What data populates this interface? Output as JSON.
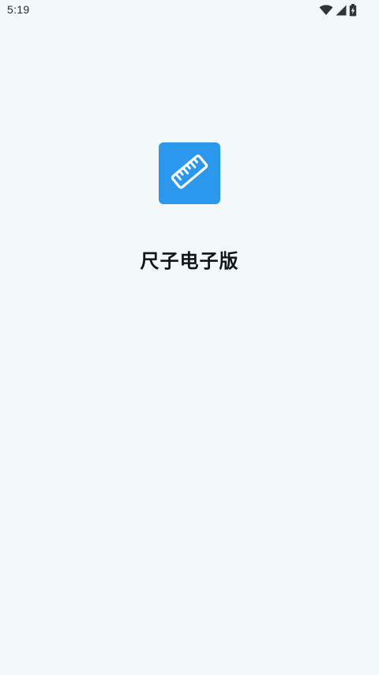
{
  "status_bar": {
    "time": "5:19",
    "icons": [
      "wifi-icon",
      "cellular-signal-icon",
      "battery-charging-icon"
    ]
  },
  "splash": {
    "icon": "ruler-icon",
    "icon_color": "#2b98ed",
    "app_name": "尺子电子版"
  },
  "colors": {
    "background": "#f3f9fa",
    "text": "#141414"
  }
}
